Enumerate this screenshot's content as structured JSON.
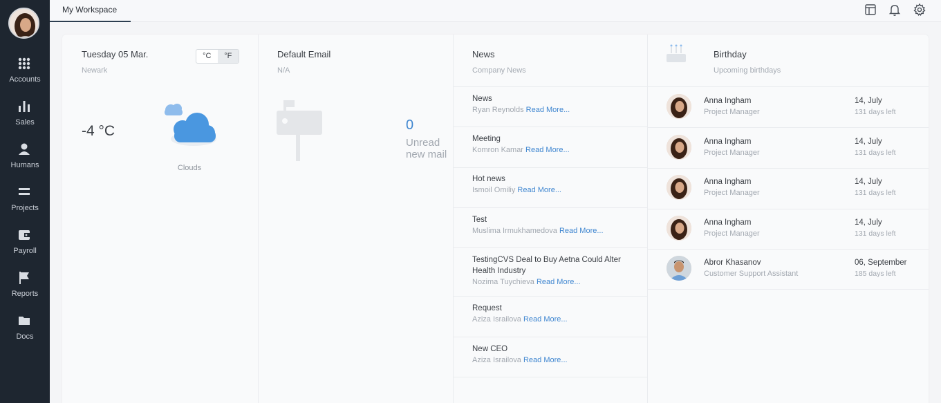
{
  "sidebar": {
    "items": [
      {
        "label": "Accounts",
        "icon": "grid-dots-icon"
      },
      {
        "label": "Sales",
        "icon": "bar-chart-icon"
      },
      {
        "label": "Humans",
        "icon": "person-icon"
      },
      {
        "label": "Projects",
        "icon": "equals-icon"
      },
      {
        "label": "Payroll",
        "icon": "wallet-icon"
      },
      {
        "label": "Reports",
        "icon": "flag-icon"
      },
      {
        "label": "Docs",
        "icon": "folder-icon"
      }
    ]
  },
  "topbar": {
    "tab_label": "My Workspace",
    "icons": [
      "layout-icon",
      "bell-icon",
      "gear-icon"
    ]
  },
  "weather": {
    "date": "Tuesday 05 Mar.",
    "city": "Newark",
    "unit_c": "°C",
    "unit_f": "°F",
    "temperature": "-4 °C",
    "condition": "Clouds"
  },
  "email": {
    "title": "Default Email",
    "subtitle": "N/A",
    "unread_count": "0",
    "unread_label": "Unread new mail"
  },
  "news": {
    "title": "News",
    "subtitle": "Company News",
    "read_more": "Read More...",
    "items": [
      {
        "title": "News",
        "author": "Ryan Reynolds"
      },
      {
        "title": "Meeting",
        "author": "Komron Kamar"
      },
      {
        "title": "Hot news",
        "author": "Ismoil Omiliy"
      },
      {
        "title": "Test",
        "author": "Muslima Irmukhamedova"
      },
      {
        "title": "TestingCVS Deal to Buy Aetna Could Alter Health Industry",
        "author": "Nozima Tuychieva"
      },
      {
        "title": "Request",
        "author": "Aziza Israilova"
      },
      {
        "title": "New CEO",
        "author": "Aziza Israilova"
      }
    ]
  },
  "birthday": {
    "title": "Birthday",
    "subtitle": "Upcoming birthdays",
    "items": [
      {
        "name": "Anna Ingham",
        "role": "Project Manager",
        "date": "14, July",
        "left": "131 days left"
      },
      {
        "name": "Anna Ingham",
        "role": "Project Manager",
        "date": "14, July",
        "left": "131 days left"
      },
      {
        "name": "Anna Ingham",
        "role": "Project Manager",
        "date": "14, July",
        "left": "131 days left"
      },
      {
        "name": "Anna Ingham",
        "role": "Project Manager",
        "date": "14, July",
        "left": "131 days left"
      },
      {
        "name": "Abror Khasanov",
        "role": "Customer Support Assistant",
        "date": "06, September",
        "left": "185 days left"
      }
    ]
  },
  "colors": {
    "sidebar_bg": "#1e2630",
    "accent_blue": "#3f86d0",
    "cloud_blue": "#4a97e0"
  }
}
